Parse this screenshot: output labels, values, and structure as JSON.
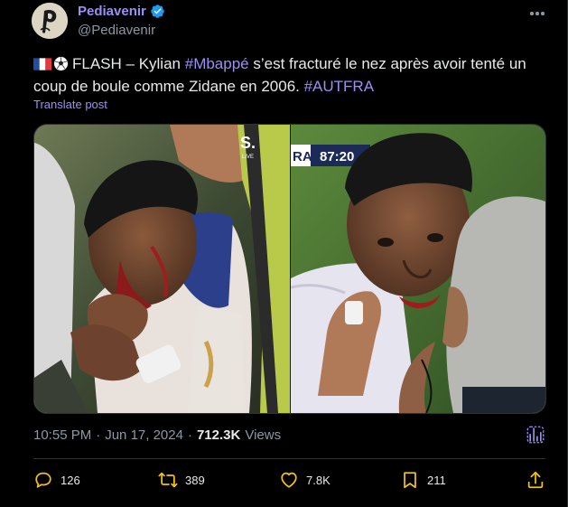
{
  "author": {
    "name": "Pediavenir",
    "handle": "@Pediavenir",
    "verified": true,
    "avatar_icon": "stylized-p-logo"
  },
  "tweet": {
    "flag_icon": "france-flag-emoji",
    "ball_icon": "soccer-ball-emoji",
    "text_before": "FLASH – Kylian ",
    "hashtag1": "#Mbappé",
    "text_middle": " s’est fracturé le nez après avoir tenté un coup de boule comme Zidane en 2006. ",
    "hashtag2": "#AUTFRA",
    "translate_label": "Translate post"
  },
  "media": {
    "left_overlay": "S.",
    "left_overlay_small": "LIVE",
    "right_score_team": "RA",
    "right_clock": "87:20"
  },
  "meta": {
    "time": "10:55 PM",
    "sep": "·",
    "date": "Jun 17, 2024",
    "sep2": "·",
    "views_count": "712.3K",
    "views_label": "Views"
  },
  "actions": {
    "replies": "126",
    "reposts": "389",
    "likes": "7.8K",
    "bookmarks": "211"
  },
  "colors": {
    "accent": "#9b8ff5",
    "background": "#000000",
    "muted": "#8b98a5",
    "verified": "#1d9bf0"
  }
}
